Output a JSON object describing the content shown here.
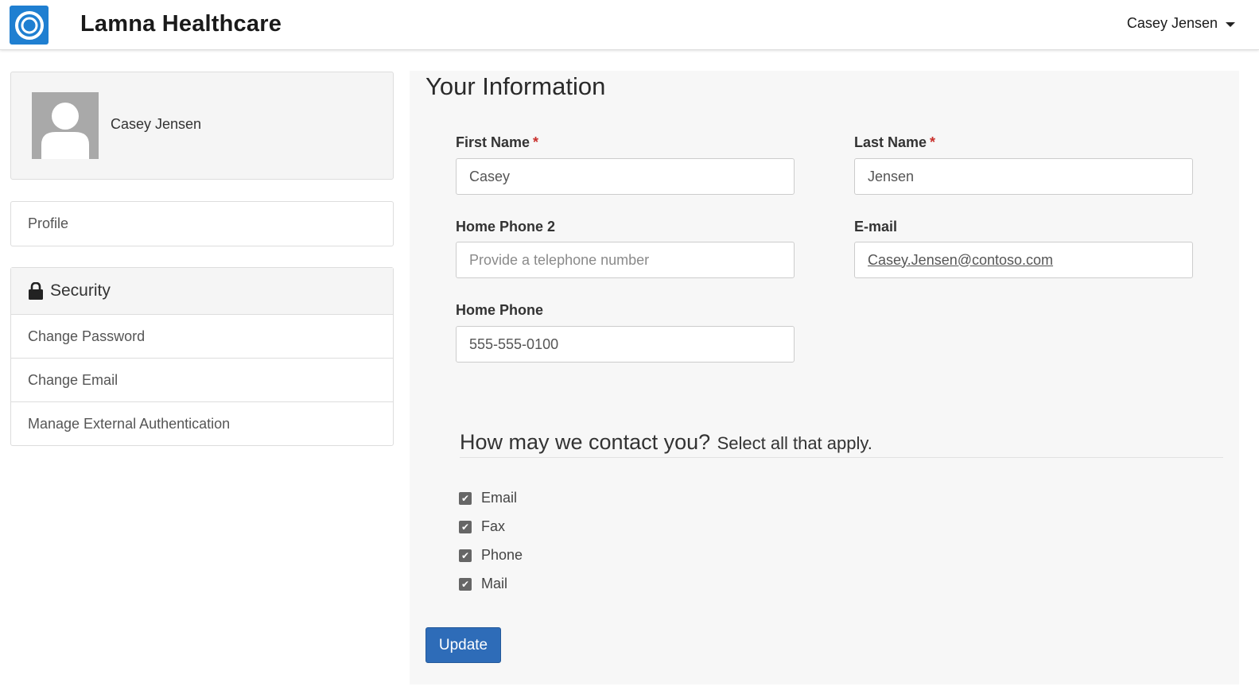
{
  "header": {
    "brand": "Lamna Healthcare",
    "logo_icon": "ring-logo-icon",
    "user_name": "Casey Jensen",
    "accent_color": "#1f7fd1"
  },
  "sidebar": {
    "profile_name": "Casey Jensen",
    "profile_link": "Profile",
    "security": {
      "title": "Security",
      "icon": "lock-icon",
      "items": [
        "Change Password",
        "Change Email",
        "Manage External Authentication"
      ]
    }
  },
  "main": {
    "title": "Your Information",
    "fields": {
      "first_name": {
        "label": "First Name",
        "value": "Casey",
        "required": true
      },
      "last_name": {
        "label": "Last Name",
        "value": "Jensen",
        "required": true
      },
      "home_phone_2": {
        "label": "Home Phone 2",
        "value": "",
        "placeholder": "Provide a telephone number"
      },
      "email": {
        "label": "E-mail",
        "value": "Casey.Jensen@contoso.com"
      },
      "home_phone": {
        "label": "Home Phone",
        "value": "555-555-0100"
      }
    },
    "required_marker": "*",
    "contact": {
      "question": "How may we contact you?",
      "subtitle": "Select all that apply.",
      "options": [
        {
          "label": "Email",
          "checked": true
        },
        {
          "label": "Fax",
          "checked": true
        },
        {
          "label": "Phone",
          "checked": true
        },
        {
          "label": "Mail",
          "checked": true
        }
      ]
    },
    "update_label": "Update",
    "button_color": "#2e6cb8"
  }
}
